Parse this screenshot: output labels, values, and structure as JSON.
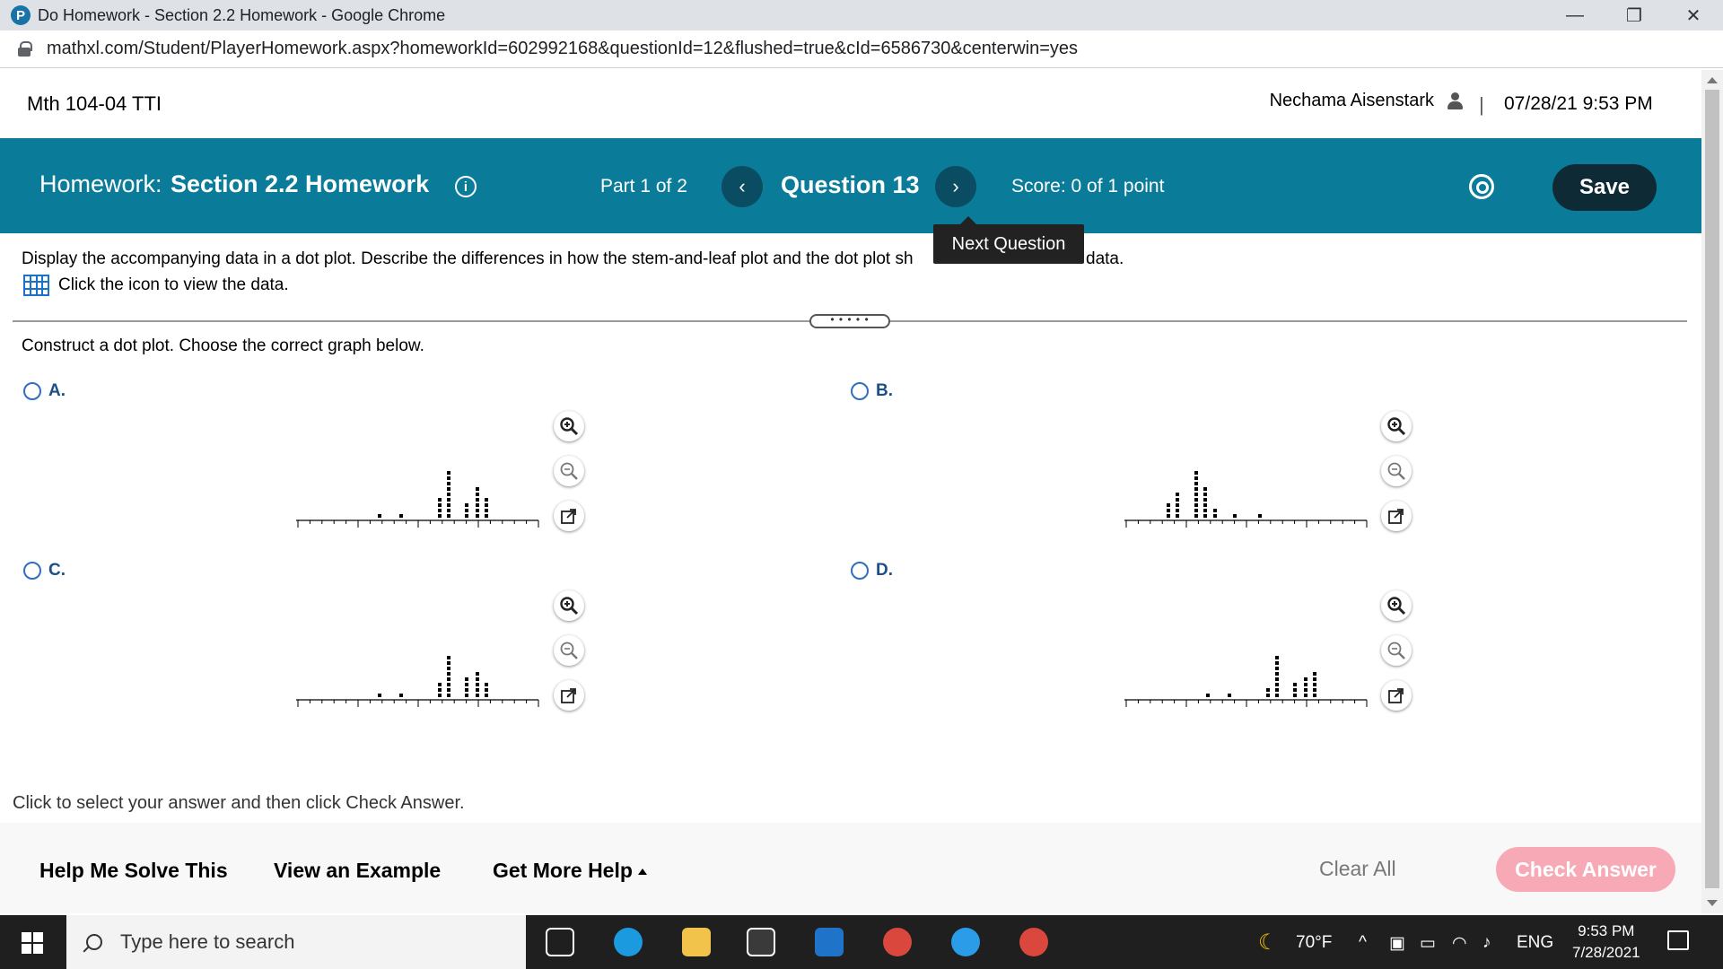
{
  "window": {
    "title": "Do Homework - Section 2.2 Homework - Google Chrome",
    "app_icon_letter": "P",
    "minimize": "—",
    "restore": "❐",
    "close": "✕"
  },
  "browser": {
    "url": "mathxl.com/Student/PlayerHomework.aspx?homeworkId=602992168&questionId=12&flushed=true&cId=6586730&centerwin=yes"
  },
  "header": {
    "course": "Mth 104-04 TTI",
    "user_name": "Nechama Aisenstark",
    "separator": "|",
    "datetime": "07/28/21 9:53 PM"
  },
  "homework_bar": {
    "label": "Homework:",
    "title": "Section 2.2 Homework",
    "info_glyph": "i",
    "part": "Part 1 of 2",
    "prev_glyph": "‹",
    "question": "Question 13",
    "next_glyph": "›",
    "score": "Score: 0 of 1 point",
    "save_label": "Save",
    "next_tooltip": "Next Question"
  },
  "question": {
    "prompt": "Display the accompanying data in a dot plot. Describe the differences in how the stem-and-leaf plot and the dot plot sh",
    "prompt_tail": "data.",
    "data_link": "Click the icon to view the data.",
    "divider_handle": "• • • • •",
    "instruction": "Construct a dot plot. Choose the correct graph below.",
    "footer": "Click to select your answer and then click Check Answer."
  },
  "options": [
    {
      "letter": "A.",
      "ticks": [
        "0",
        "1",
        "2",
        "3",
        "4"
      ]
    },
    {
      "letter": "B.",
      "ticks": [
        "0",
        "1",
        "2",
        "3",
        "4"
      ]
    },
    {
      "letter": "C.",
      "ticks": [
        "0",
        "10",
        "20",
        "30",
        "40"
      ]
    },
    {
      "letter": "D.",
      "ticks": [
        "0",
        "1",
        "2",
        "3",
        "4"
      ]
    }
  ],
  "help": {
    "solve": "Help Me Solve This",
    "example": "View an Example",
    "more": "Get More Help",
    "clear": "Clear All",
    "check": "Check Answer"
  },
  "taskbar": {
    "search_placeholder": "Type here to search",
    "weather": "70°F",
    "language": "ENG",
    "time": "9:53 PM",
    "date": "7/28/2021"
  },
  "colors": {
    "teal_bar": "#0a7c99",
    "save_button": "#0d2a35",
    "check_answer": "#f7aab5",
    "radio": "#2f6fbd"
  }
}
